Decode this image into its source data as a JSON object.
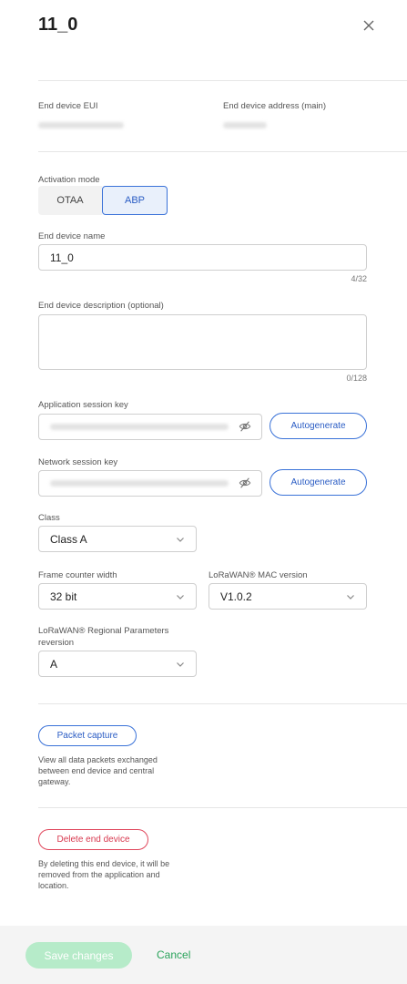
{
  "header": {
    "title": "11_0"
  },
  "info": {
    "eui_label": "End device EUI",
    "address_label": "End device address (main)"
  },
  "activation": {
    "label": "Activation mode",
    "options": [
      "OTAA",
      "ABP"
    ],
    "selected": "ABP"
  },
  "name_field": {
    "label": "End device name",
    "value": "11_0",
    "counter": "4/32"
  },
  "description_field": {
    "label": "End device description (optional)",
    "value": "",
    "counter": "0/128"
  },
  "app_session_key": {
    "label": "Application session key",
    "button": "Autogenerate"
  },
  "net_session_key": {
    "label": "Network session key",
    "button": "Autogenerate"
  },
  "class_field": {
    "label": "Class",
    "value": "Class A"
  },
  "frame_counter": {
    "label": "Frame counter width",
    "value": "32 bit"
  },
  "mac_version": {
    "label": "LoRaWAN® MAC version",
    "value": "V1.0.2"
  },
  "regional_params": {
    "label_line1": "LoRaWAN® Regional Parameters",
    "label_line2": "reversion",
    "value": "A"
  },
  "packet_capture": {
    "button": "Packet capture",
    "help_line1": "View all data packets exchanged",
    "help_line2": "between end device and central",
    "help_line3": "gateway."
  },
  "delete": {
    "button": "Delete end device",
    "help_line1": "By deleting this end device, it will be",
    "help_line2": "removed from the application and",
    "help_line3": "location."
  },
  "footer": {
    "save_label": "Save changes",
    "cancel_label": "Cancel"
  },
  "colors": {
    "accent": "#3a72d8",
    "success": "#2aa35b",
    "danger": "#e0475c",
    "save_disabled": "#b6ebc9"
  }
}
